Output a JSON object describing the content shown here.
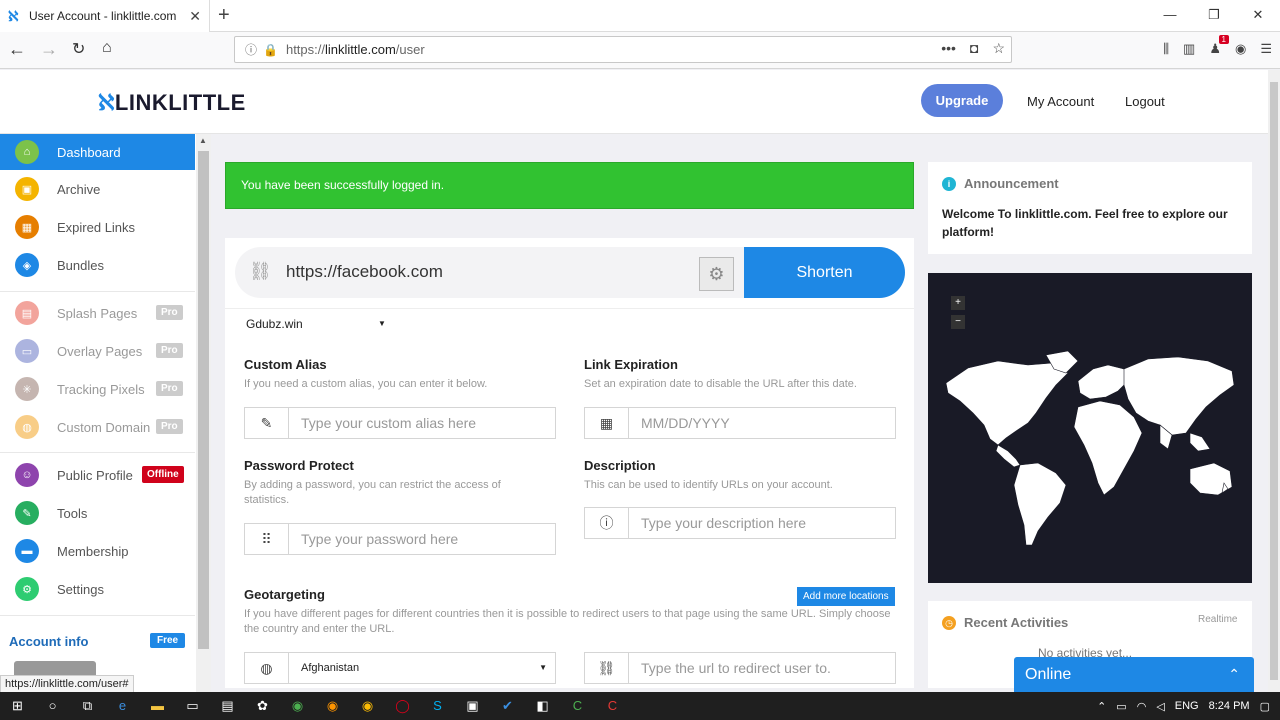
{
  "browser": {
    "tab_title": "User Account - linklittle.com",
    "url_prefix": "https://",
    "url_host": "linklittle.com",
    "url_path": "/user",
    "status_url": "https://linklittle.com/user#",
    "notif_count": "1"
  },
  "header": {
    "logo_text": "LINKLITTLE",
    "upgrade_label": "Upgrade",
    "my_account_label": "My Account",
    "logout_label": "Logout"
  },
  "sidebar": {
    "items": [
      {
        "label": "Dashboard",
        "color": "#7cc24a"
      },
      {
        "label": "Archive",
        "color": "#f4b400"
      },
      {
        "label": "Expired Links",
        "color": "#e67e00"
      },
      {
        "label": "Bundles",
        "color": "#1e88e5"
      },
      {
        "label": "Splash Pages",
        "color": "#e74c3c",
        "badge": "Pro"
      },
      {
        "label": "Overlay Pages",
        "color": "#5c6bc0",
        "badge": "Pro"
      },
      {
        "label": "Tracking Pixels",
        "color": "#8d6e63",
        "badge": "Pro"
      },
      {
        "label": "Custom Domain",
        "color": "#f39c12",
        "badge": "Pro"
      },
      {
        "label": "Public Profile",
        "color": "#8e44ad",
        "badge": "Offline"
      },
      {
        "label": "Tools",
        "color": "#27ae60"
      },
      {
        "label": "Membership",
        "color": "#1e88e5"
      },
      {
        "label": "Settings",
        "color": "#2ecc71"
      }
    ],
    "account_info_label": "Account info",
    "account_plan": "Free"
  },
  "alert": {
    "message": "You have been successfully logged in."
  },
  "shortener": {
    "url_value": "https://facebook.com",
    "shorten_label": "Shorten",
    "domain_selected": "Gdubz.win"
  },
  "form": {
    "alias": {
      "label": "Custom Alias",
      "help": "If you need a custom alias, you can enter it below.",
      "placeholder": "Type your custom alias here"
    },
    "expiration": {
      "label": "Link Expiration",
      "help": "Set an expiration date to disable the URL after this date.",
      "placeholder": "MM/DD/YYYY"
    },
    "password": {
      "label": "Password Protect",
      "help": "By adding a password, you can restrict the access of statistics.",
      "placeholder": "Type your password here"
    },
    "description": {
      "label": "Description",
      "help": "This can be used to identify URLs on your account.",
      "placeholder": "Type your description here"
    },
    "geo": {
      "label": "Geotargeting",
      "help": "If you have different pages for different countries then it is possible to redirect users to that page using the same URL. Simply choose the country and enter the URL.",
      "add_label": "Add more locations",
      "country": "Afghanistan",
      "url_placeholder": "Type the url to redirect user to."
    }
  },
  "announcement": {
    "title": "Announcement",
    "message": "Welcome To linklittle.com. Feel free to explore our platform!"
  },
  "recent": {
    "title": "Recent Activities",
    "realtime": "Realtime",
    "empty": "No activities yet..."
  },
  "chat": {
    "label": "Online"
  },
  "taskbar": {
    "lang": "ENG",
    "time": "8:24 PM"
  }
}
